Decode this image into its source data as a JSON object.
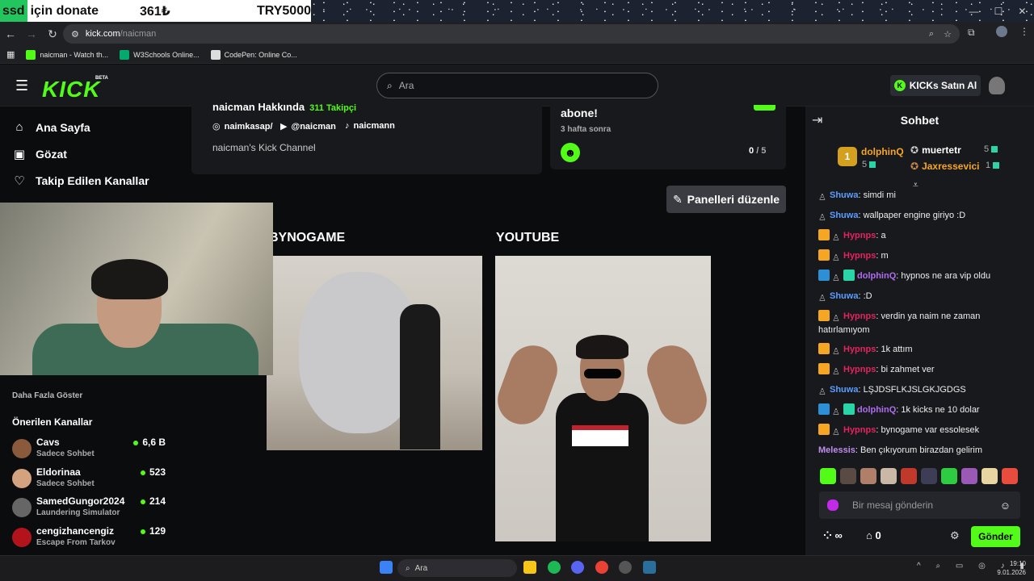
{
  "donate": {
    "tag": "ssd",
    "text": "için donate",
    "amount": "361₺",
    "goal": "TRY5000"
  },
  "browser": {
    "host": "kick.com",
    "path": "/naicman"
  },
  "bookmarks": [
    {
      "label": "naicman - Watch th...",
      "color": "#53fc18"
    },
    {
      "label": "W3Schools Online...",
      "color": "#04aa6d"
    },
    {
      "label": "CodePen: Online Co...",
      "color": "#dddddd"
    }
  ],
  "header": {
    "logo": "KICK",
    "beta": "BETA",
    "search_placeholder": "Ara",
    "buy_kicks": "KICKs Satın Al"
  },
  "sidebar": {
    "items": [
      {
        "label": "Ana Sayfa",
        "icon": "⌂"
      },
      {
        "label": "Gözat",
        "icon": "▣"
      },
      {
        "label": "Takip Edilen Kanallar",
        "icon": "♡"
      }
    ],
    "show_more": "Daha Fazla Göster",
    "recommended_title": "Önerilen Kanallar",
    "recommended": [
      {
        "name": "Cavs",
        "category": "Sadece Sohbet",
        "viewers": "6,6 B",
        "color": "#8a5a3c"
      },
      {
        "name": "Eldorinaa",
        "category": "Sadece Sohbet",
        "viewers": "523",
        "color": "#d3a27f"
      },
      {
        "name": "SamedGungor2024",
        "category": "Laundering Simulator",
        "viewers": "214",
        "color": "#666666"
      },
      {
        "name": "cengizhancengiz",
        "category": "Escape From Tarkov",
        "viewers": "129",
        "color": "#b3141b"
      }
    ]
  },
  "about": {
    "title": "naicman Hakkında",
    "followers": "311 Takipçi",
    "socials": [
      {
        "icon": "◎",
        "label": "naimkasap/"
      },
      {
        "icon": "▶",
        "label": "@naicman"
      },
      {
        "icon": "♪",
        "label": "naicmann"
      }
    ],
    "description": "naicman's Kick Channel"
  },
  "sub_goal": {
    "title": "abone!",
    "time": "3 hafta sonra",
    "current": "0",
    "total": "/ 5"
  },
  "edit_panels": "Panelleri düzenle",
  "panels": [
    {
      "title": "BYNOGAME"
    },
    {
      "title": "YOUTUBE"
    }
  ],
  "chat": {
    "title": "Sohbet",
    "leaderboard": [
      {
        "name": "dolphinQ",
        "count": "5",
        "rank": "1"
      },
      {
        "name": "muertetr",
        "count": "5"
      },
      {
        "name": "Jaxressevici",
        "count": "1"
      }
    ],
    "messages": [
      {
        "user": "Shuwa",
        "color": "#5b9dff",
        "badges": [
          "grey"
        ],
        "text": ": simdi mi"
      },
      {
        "user": "Shuwa",
        "color": "#5b9dff",
        "badges": [
          "grey"
        ],
        "text": ": wallpaper engine giriyo :D"
      },
      {
        "user": "Hypnps",
        "color": "#e3245f",
        "badges": [
          "crown",
          "grey"
        ],
        "text": ": a"
      },
      {
        "user": "Hypnps",
        "color": "#e3245f",
        "badges": [
          "crown",
          "grey"
        ],
        "text": ": m"
      },
      {
        "user": "dolphinQ",
        "color": "#b06cf0",
        "badges": [
          "mod",
          "grey",
          "sub"
        ],
        "text": ": hypnos ne ara vip oldu"
      },
      {
        "user": "Shuwa",
        "color": "#5b9dff",
        "badges": [
          "grey"
        ],
        "text": ": :D"
      },
      {
        "user": "Hypnps",
        "color": "#e3245f",
        "badges": [
          "crown",
          "grey"
        ],
        "text": ": verdin ya naim ne zaman hatırlamıyom"
      },
      {
        "user": "Hypnps",
        "color": "#e3245f",
        "badges": [
          "crown",
          "grey"
        ],
        "text": ": 1k attım"
      },
      {
        "user": "Hypnps",
        "color": "#e3245f",
        "badges": [
          "crown",
          "grey"
        ],
        "text": ": bi zahmet ver"
      },
      {
        "user": "Shuwa",
        "color": "#5b9dff",
        "badges": [
          "grey"
        ],
        "text": ": LŞJDSFLKJSLGKJGDGS"
      },
      {
        "user": "dolphinQ",
        "color": "#b06cf0",
        "badges": [
          "mod",
          "grey",
          "sub"
        ],
        "text": ": 1k kicks ne 10 dolar"
      },
      {
        "user": "Hypnps",
        "color": "#e3245f",
        "badges": [
          "crown",
          "grey"
        ],
        "text": ": bynogame var essolesek"
      },
      {
        "user": "Melessis",
        "color": "#c08cf0",
        "badges": [],
        "text": ": Ben çıkıyorum birazdan gelirim"
      }
    ],
    "input_placeholder": "Bir mesaj gönderin",
    "send": "Gönder",
    "points": "∞",
    "store_count": "0"
  },
  "taskbar": {
    "search": "Ara",
    "time": "19:10",
    "date": "9.01.2026"
  }
}
